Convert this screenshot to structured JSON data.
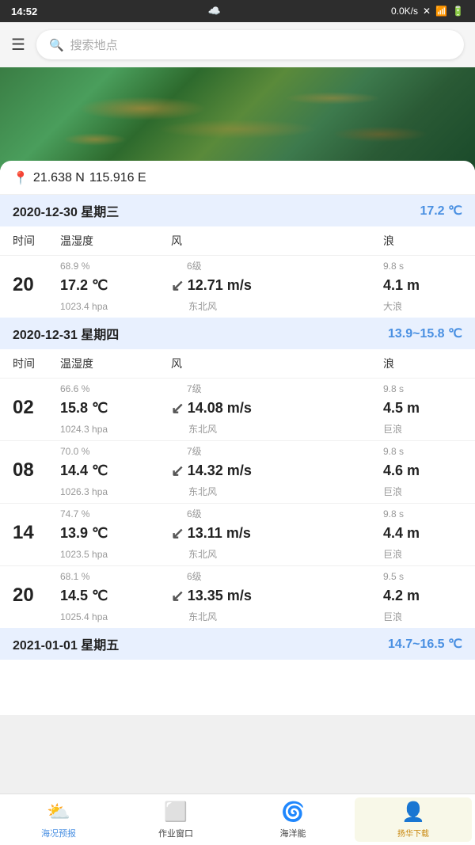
{
  "statusBar": {
    "time": "14:52",
    "network": "0.0K/s",
    "battery": "100"
  },
  "searchBar": {
    "menuIcon": "☰",
    "placeholder": "搜索地点"
  },
  "location": {
    "lat": "21.638 N",
    "lon": "115.916 E",
    "pinIcon": "📍"
  },
  "days": [
    {
      "id": "day1",
      "header": "2020-12-30 星期三",
      "tempRange": "17.2 ℃",
      "colHeaders": [
        "时间",
        "温湿度",
        "风",
        "浪"
      ],
      "rows": [
        {
          "time": "20",
          "humidity": "68.9 %",
          "windLevel": "6级",
          "waveSeconds": "9.8 s",
          "temp": "17.2 ℃",
          "windSpeed": "12.71 m/s",
          "waveHeight": "4.1 m",
          "pressure": "1023.4 hpa",
          "windDir": "东北风",
          "waveType": "大浪",
          "windArrow": "↙"
        }
      ]
    },
    {
      "id": "day2",
      "header": "2020-12-31 星期四",
      "tempRange": "13.9~15.8 ℃",
      "colHeaders": [
        "时间",
        "温湿度",
        "风",
        "浪"
      ],
      "rows": [
        {
          "time": "02",
          "humidity": "66.6 %",
          "windLevel": "7级",
          "waveSeconds": "9.8 s",
          "temp": "15.8 ℃",
          "windSpeed": "14.08 m/s",
          "waveHeight": "4.5 m",
          "pressure": "1024.3 hpa",
          "windDir": "东北风",
          "waveType": "巨浪",
          "windArrow": "↙"
        },
        {
          "time": "08",
          "humidity": "70.0 %",
          "windLevel": "7级",
          "waveSeconds": "9.8 s",
          "temp": "14.4 ℃",
          "windSpeed": "14.32 m/s",
          "waveHeight": "4.6 m",
          "pressure": "1026.3 hpa",
          "windDir": "东北风",
          "waveType": "巨浪",
          "windArrow": "↙"
        },
        {
          "time": "14",
          "humidity": "74.7 %",
          "windLevel": "6级",
          "waveSeconds": "9.8 s",
          "temp": "13.9 ℃",
          "windSpeed": "13.11 m/s",
          "waveHeight": "4.4 m",
          "pressure": "1023.5 hpa",
          "windDir": "东北风",
          "waveType": "巨浪",
          "windArrow": "↙"
        },
        {
          "time": "20",
          "humidity": "68.1 %",
          "windLevel": "6级",
          "waveSeconds": "9.5 s",
          "temp": "14.5 ℃",
          "windSpeed": "13.35 m/s",
          "waveHeight": "4.2 m",
          "pressure": "1025.4 hpa",
          "windDir": "东北风",
          "waveType": "巨浪",
          "windArrow": "↙"
        }
      ]
    },
    {
      "id": "day3",
      "header": "2021-01-01 星期五",
      "tempRange": "14.7~16.5 ℃",
      "colHeaders": [],
      "rows": []
    }
  ],
  "bottomNav": [
    {
      "id": "forecast",
      "icon": "🌤",
      "label": "海况预报",
      "active": true
    },
    {
      "id": "window",
      "icon": "🗗",
      "label": "作业窗口",
      "active": false
    },
    {
      "id": "ocean",
      "icon": "🌊",
      "label": "海洋能",
      "active": false
    },
    {
      "id": "watermark",
      "icon": "👤",
      "label": "扬华下载",
      "active": false
    }
  ]
}
